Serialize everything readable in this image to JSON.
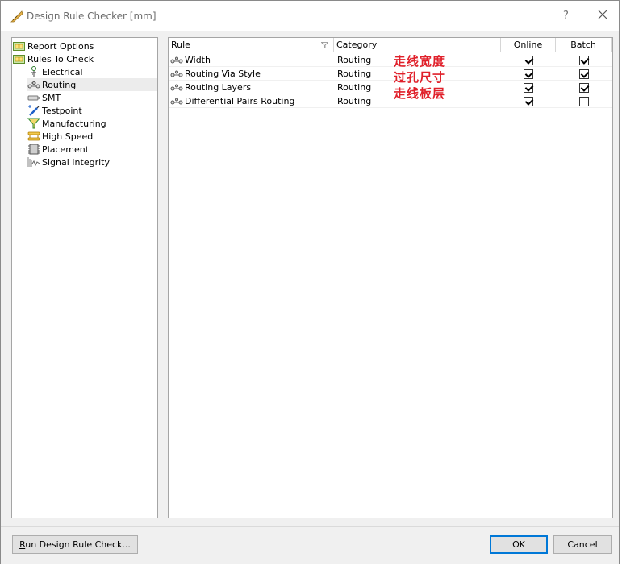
{
  "window": {
    "title": "Design Rule Checker [mm]",
    "help_label": "?"
  },
  "tree": {
    "items": [
      {
        "label": "Report Options",
        "icon": "folder-report-icon",
        "level": 0
      },
      {
        "label": "Rules To Check",
        "icon": "folder-rules-icon",
        "level": 0
      },
      {
        "label": "Electrical",
        "icon": "electrical-icon",
        "level": 1
      },
      {
        "label": "Routing",
        "icon": "routing-icon",
        "level": 1,
        "selected": true
      },
      {
        "label": "SMT",
        "icon": "smt-icon",
        "level": 1
      },
      {
        "label": "Testpoint",
        "icon": "testpoint-icon",
        "level": 1
      },
      {
        "label": "Manufacturing",
        "icon": "manufacturing-icon",
        "level": 1
      },
      {
        "label": "High Speed",
        "icon": "high-speed-icon",
        "level": 1
      },
      {
        "label": "Placement",
        "icon": "placement-icon",
        "level": 1
      },
      {
        "label": "Signal Integrity",
        "icon": "signal-integrity-icon",
        "level": 1
      }
    ]
  },
  "grid": {
    "columns": {
      "rule": "Rule",
      "category": "Category",
      "online": "Online",
      "batch": "Batch"
    },
    "rows": [
      {
        "rule": "Width",
        "category": "Routing",
        "online": true,
        "batch": true
      },
      {
        "rule": "Routing Via Style",
        "category": "Routing",
        "online": true,
        "batch": true
      },
      {
        "rule": "Routing Layers",
        "category": "Routing",
        "online": true,
        "batch": true
      },
      {
        "rule": "Differential Pairs Routing",
        "category": "Routing",
        "online": true,
        "batch": false
      }
    ]
  },
  "annotations": [
    "走线宽度",
    "过孔尺寸",
    "走线板层"
  ],
  "buttons": {
    "run_drc_prefix": "R",
    "run_drc_rest": "un Design Rule Check...",
    "ok": "OK",
    "cancel": "Cancel"
  },
  "colors": {
    "annotation": "#e0202a",
    "focus_border": "#0078d7"
  }
}
